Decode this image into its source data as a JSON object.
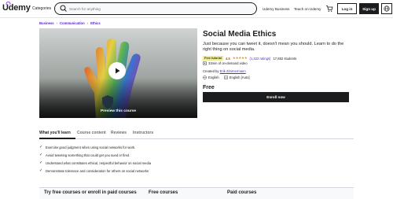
{
  "header": {
    "logo": "Udemy",
    "categories_label": "Categories",
    "search_placeholder": "Search for anything",
    "business_link": "Udemy Business",
    "teach_link": "Teach on Udemy",
    "login_label": "Log in",
    "signup_label": "Sign up"
  },
  "breadcrumb": [
    "Business",
    "Communication",
    "Ethics"
  ],
  "hero": {
    "preview_label": "Preview this course"
  },
  "course": {
    "title": "Social Media Ethics",
    "subtitle": "Just because you can tweet it, doesn't mean you should. Learn to do the right thing on social media.",
    "badge": "Free tutorial",
    "rating_value": "4.6",
    "stars": "★★★★★",
    "rating_count": "(1,422 ratings)",
    "students": "17,852 students",
    "video_length": "33min of on-demand video",
    "created_by_label": "Created by",
    "author": "Erik Zimmermann",
    "language": "English",
    "captions": "English [Auto]",
    "price": "Free",
    "enroll_label": "Enroll now"
  },
  "tabs": [
    "What you'll learn",
    "Course content",
    "Reviews",
    "Instructors"
  ],
  "learn_items": [
    "Exercise good judgment when using social networks for work.",
    "Avoid tweeting something that could get you sued or fired",
    "Understand what constitutes ethical, respectful behavior on social media",
    "Demonstrate tolerance and consideration for others on social networks"
  ],
  "compare": {
    "col1": "Try free courses or enroll in paid courses",
    "col2": "Free courses",
    "col3": "Paid courses"
  },
  "colors": {
    "accent": "#a435f0",
    "link": "#5624d0",
    "dark": "#1c1d1f",
    "badge_bg": "#eceb98",
    "star": "#e59819"
  }
}
